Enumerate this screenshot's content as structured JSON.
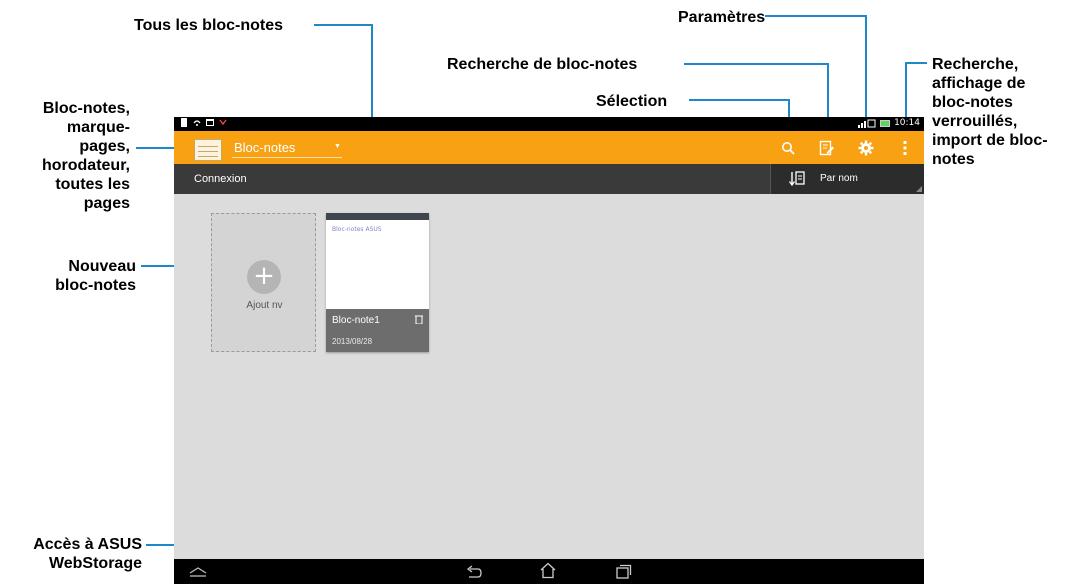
{
  "annotations": {
    "tous_bloc_notes": "Tous les bloc-notes",
    "parametres": "Paramètres",
    "recherche_bloc_notes": "Recherche de bloc-notes",
    "selection": "Sélection",
    "recherche_affichage": [
      "Recherche,",
      "affichage de",
      "bloc-notes",
      "verrouillés,",
      "import de bloc-",
      "notes"
    ],
    "bloc_notes_marque": [
      "Bloc-notes,",
      "marque-",
      "pages,",
      "horodateur,",
      "toutes les",
      "pages"
    ],
    "nouveau": [
      "Nouveau",
      "bloc-notes"
    ],
    "acces_webstorage": [
      "Accès à ASUS",
      "WebStorage"
    ]
  },
  "status_bar": {
    "time": "10:14"
  },
  "action_bar": {
    "title": "Bloc-notes",
    "icons": [
      "search-icon",
      "edit-notebook-icon",
      "gear-icon",
      "overflow-menu-icon"
    ]
  },
  "sub_bar": {
    "webstorage_label": "Connexion",
    "sort_label": "Par nom"
  },
  "notebooks": {
    "add_label": "Ajout nv",
    "items": [
      {
        "name": "Bloc-note1",
        "date": "2013/08/28",
        "preview": "Bloc-notes ASUS"
      }
    ]
  },
  "colors": {
    "action_bar": "#f7a113",
    "callout_line": "#1e88c8",
    "sub_bar": "#3a3a3a",
    "content_bg": "#dcdcdc"
  }
}
